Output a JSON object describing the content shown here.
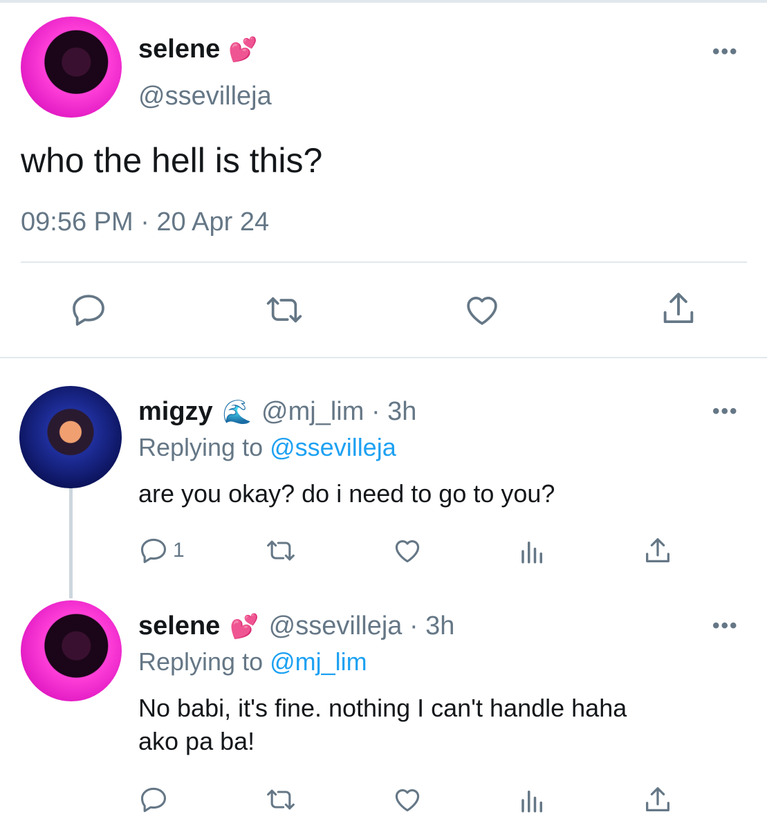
{
  "main_tweet": {
    "name": "selene",
    "emoji": "💕",
    "handle": "@ssevilleja",
    "text": "who the hell is this?",
    "timestamp": "09:56 PM · 20 Apr 24",
    "more_label": "•••"
  },
  "replies": [
    {
      "name": "migzy",
      "emoji": "🌊",
      "handle_time": "@mj_lim · 3h",
      "replying_label": "Replying to",
      "replying_handle": "@ssevilleja",
      "text": "are you okay? do i need to go to you?",
      "reply_count": "1",
      "more_label": "•••"
    },
    {
      "name": "selene",
      "emoji": "💕",
      "handle_time": "@ssevilleja · 3h",
      "replying_label": "Replying to",
      "replying_handle": "@mj_lim",
      "text_line1": "No babi, it's fine. nothing I can't handle haha",
      "text_line2": "ako pa ba!",
      "reply_count": "",
      "more_label": "•••"
    }
  ],
  "icons": [
    "reply-icon",
    "retweet-icon",
    "like-icon",
    "share-icon",
    "analytics-icon",
    "more-icon"
  ]
}
